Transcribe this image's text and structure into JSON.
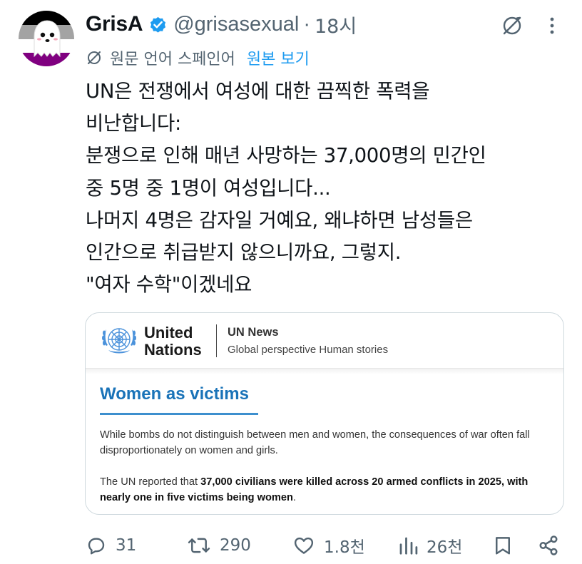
{
  "author": {
    "name": "GrisA",
    "handle": "@grisasexual",
    "separator": "·",
    "time": "18시",
    "avatar_icon": "ghost-avatar-icon",
    "verified_icon": "verified-badge-icon",
    "colors": {
      "flag_black": "#000000",
      "flag_gray": "#a3a3a3",
      "flag_white": "#ffffff",
      "flag_purple": "#800080",
      "verified": "#1d9bf0"
    }
  },
  "translation": {
    "note": "원문 언어 스페인어",
    "show_original": "원본 보기",
    "icon": "translate-icon"
  },
  "tweet": {
    "lines": [
      "UN은 전쟁에서 여성에 대한 끔찍한 폭력을",
      "비난합니다:",
      "분쟁으로 인해 매년 사망하는 37,000명의 민간인",
      "중 5명 중 1명이 여성입니다...",
      "나머지 4명은 감자일 거예요, 왜냐하면 남성들은",
      "인간으로 취급받지 않으니까요, 그렇지.",
      "\"여자 수학\"이겠네요"
    ]
  },
  "card": {
    "org_line1": "United",
    "org_line2": "Nations",
    "news_title": "UN News",
    "news_subtitle": "Global perspective Human stories",
    "section_title": "Women as victims",
    "para1": "While bombs do not distinguish between men and women, the consequences of war often fall disproportionately on women and girls.",
    "para2_prefix": "The UN reported that ",
    "para2_bold": "37,000 civilians were killed across 20 armed conflicts in 2025, with nearly one in five victims being women",
    "para2_suffix": ".",
    "colors": {
      "accent": "#1a73b8",
      "emblem": "#4b92db"
    }
  },
  "actions": {
    "replies": "31",
    "retweets": "290",
    "likes": "1.8천",
    "views": "26천"
  },
  "colors": {
    "text": "#0f1419",
    "secondary": "#536471",
    "link": "#1d9bf0",
    "border": "#cfd9de"
  }
}
